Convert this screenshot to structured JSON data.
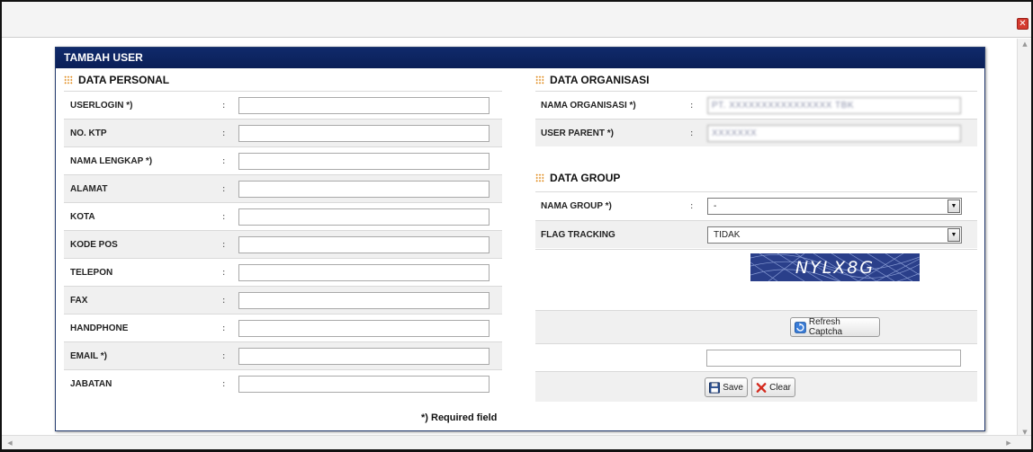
{
  "dialog": {
    "close_glyph": "✕"
  },
  "panel": {
    "title": "TAMBAH USER"
  },
  "personal": {
    "section_title": "DATA PERSONAL",
    "fields": [
      {
        "label": "USERLOGIN  *)",
        "value": ""
      },
      {
        "label": "NO. KTP",
        "value": ""
      },
      {
        "label": "NAMA LENGKAP  *)",
        "value": ""
      },
      {
        "label": "ALAMAT",
        "value": ""
      },
      {
        "label": "KOTA",
        "value": ""
      },
      {
        "label": "KODE POS",
        "value": ""
      },
      {
        "label": "TELEPON",
        "value": ""
      },
      {
        "label": "FAX",
        "value": ""
      },
      {
        "label": "HANDPHONE",
        "value": ""
      },
      {
        "label": "EMAIL  *)",
        "value": ""
      },
      {
        "label": "JABATAN",
        "value": ""
      }
    ],
    "colon": ":",
    "required_note": "*) Required field"
  },
  "organisasi": {
    "section_title": "DATA ORGANISASI",
    "nama_label": "NAMA ORGANISASI  *)",
    "nama_value": "PT. XXXXXXXXXXXXXXXX TBK",
    "parent_label": "USER PARENT  *)",
    "parent_value": "XXXXXXX"
  },
  "group": {
    "section_title": "DATA GROUP",
    "nama_group_label": "NAMA GROUP  *)",
    "nama_group_value": "-",
    "flag_label": "FLAG TRACKING",
    "flag_value": "TIDAK"
  },
  "captcha": {
    "text": "NYLX8G",
    "refresh_label": "Refresh Captcha",
    "input_value": ""
  },
  "actions": {
    "save_label": "Save",
    "clear_label": "Clear"
  },
  "colors": {
    "header": "#0a1f57",
    "accent_icon": "#e08a1a",
    "captcha_bg": "#2a3f8a",
    "clear_icon": "#d42a1e"
  }
}
